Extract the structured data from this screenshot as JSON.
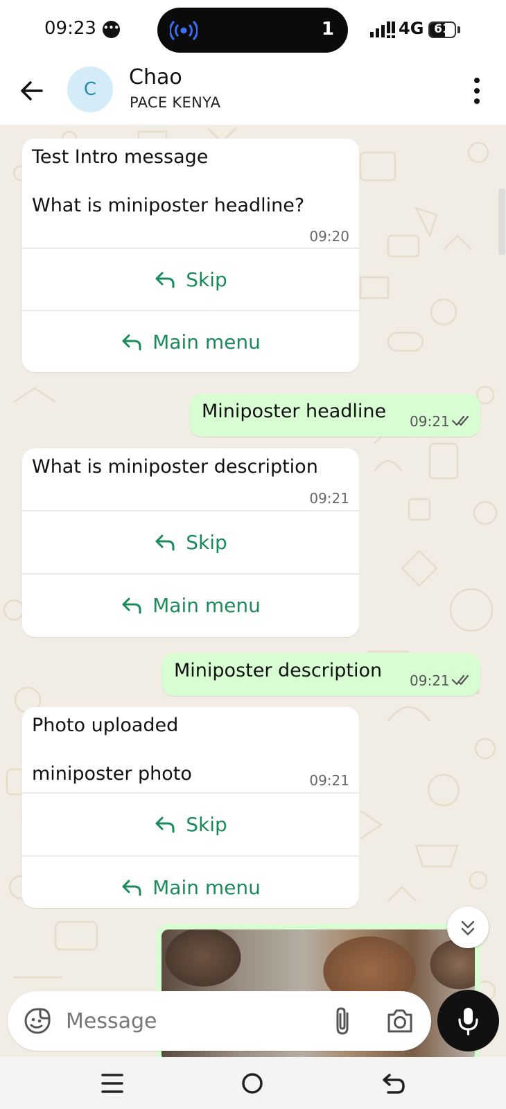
{
  "status_bar": {
    "time": "09:23",
    "pill_count": "1",
    "network": "4G",
    "battery": "61",
    "battery_level": 0.61
  },
  "header": {
    "avatar_letter": "C",
    "contact_name": "Chao",
    "contact_subtitle": "PACE KENYA"
  },
  "messages": {
    "m1": {
      "line1": "Test Intro message",
      "line2": "What is miniposter headline?",
      "time": "09:20",
      "button1": "Skip",
      "button2": "Main menu"
    },
    "m2": {
      "text": "Miniposter headline",
      "time": "09:21"
    },
    "m3": {
      "line1": "What is miniposter description",
      "time": "09:21",
      "button1": "Skip",
      "button2": "Main menu"
    },
    "m4": {
      "text": "Miniposter description",
      "time": "09:21"
    },
    "m5": {
      "line1": "Photo uploaded",
      "line2": "miniposter photo",
      "time": "09:21",
      "button1": "Skip",
      "button2": "Main menu"
    }
  },
  "composer": {
    "placeholder": "Message"
  },
  "colors": {
    "accent_green": "#1a8a5a",
    "outgoing_bubble": "#d9fdd3",
    "chat_background": "#f2ede4"
  },
  "icons": {
    "back": "arrow-left-icon",
    "menu": "more-vert-icon",
    "reply": "reply-arrow-icon",
    "read_ticks": "double-check-icon",
    "sticker": "sticker-icon",
    "attach": "paperclip-icon",
    "camera": "camera-icon",
    "mic": "mic-icon",
    "scroll_down": "double-chevron-down-icon"
  }
}
